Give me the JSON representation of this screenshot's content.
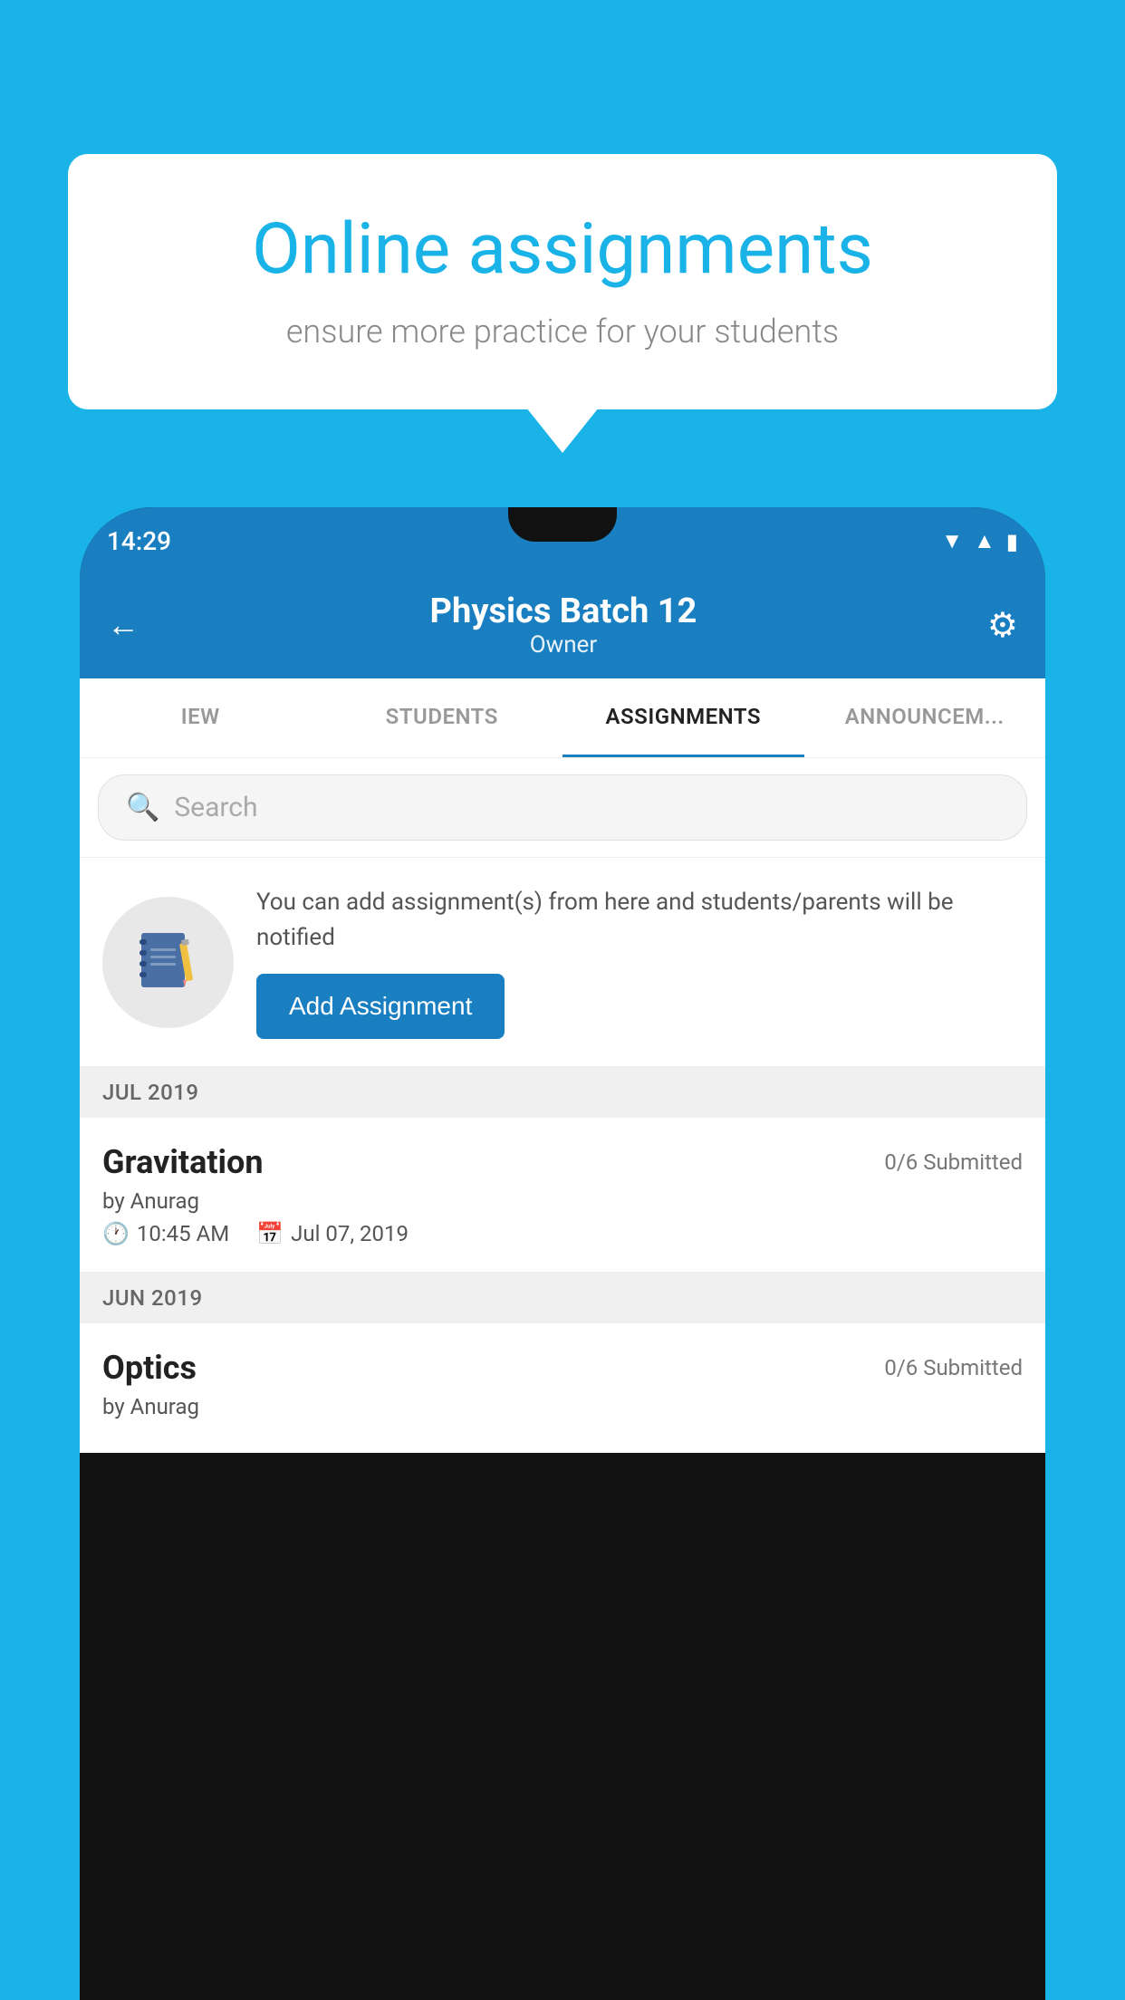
{
  "background_color": "#1ab3e8",
  "speech_bubble": {
    "title": "Online assignments",
    "subtitle": "ensure more practice for your students"
  },
  "status_bar": {
    "time": "14:29",
    "icons": [
      "wifi",
      "signal",
      "battery"
    ]
  },
  "app_header": {
    "title": "Physics Batch 12",
    "subtitle": "Owner",
    "back_label": "←",
    "settings_label": "⚙"
  },
  "tabs": [
    {
      "label": "IEW",
      "active": false
    },
    {
      "label": "STUDENTS",
      "active": false
    },
    {
      "label": "ASSIGNMENTS",
      "active": true
    },
    {
      "label": "ANNOUNCEMENTS",
      "active": false
    }
  ],
  "search": {
    "placeholder": "Search"
  },
  "add_assignment_promo": {
    "description": "You can add assignment(s) from here and students/parents will be notified",
    "button_label": "Add Assignment"
  },
  "sections": [
    {
      "month": "JUL 2019",
      "assignments": [
        {
          "name": "Gravitation",
          "submitted": "0/6 Submitted",
          "by": "by Anurag",
          "time": "10:45 AM",
          "date": "Jul 07, 2019"
        }
      ]
    },
    {
      "month": "JUN 2019",
      "assignments": [
        {
          "name": "Optics",
          "submitted": "0/6 Submitted",
          "by": "by Anurag",
          "time": "",
          "date": ""
        }
      ]
    }
  ]
}
